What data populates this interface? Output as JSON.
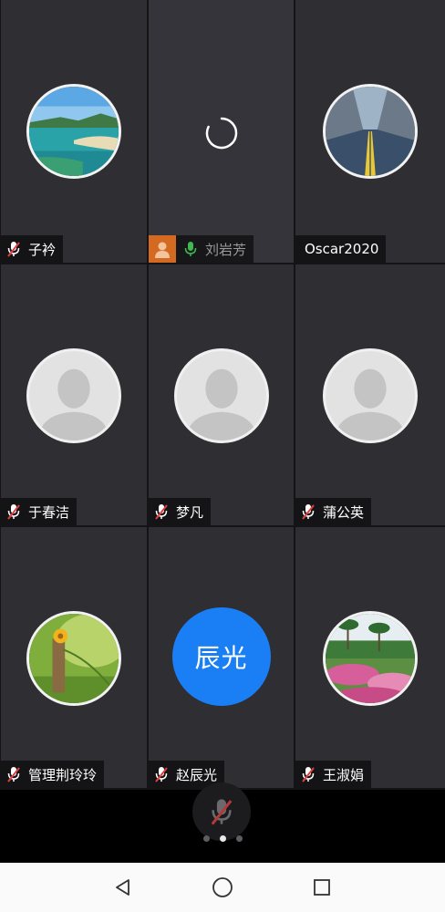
{
  "participants": [
    {
      "name": "子衿",
      "avatar": "beach-photo",
      "mic": "muted"
    },
    {
      "name": "刘岩芳",
      "avatar": "loading",
      "mic": "active"
    },
    {
      "name": "Oscar2020",
      "avatar": "street-photo",
      "mic": "none"
    },
    {
      "name": "于春洁",
      "avatar": "default-person",
      "mic": "muted"
    },
    {
      "name": "梦凡",
      "avatar": "default-person",
      "mic": "muted"
    },
    {
      "name": "蒲公英",
      "avatar": "default-person",
      "mic": "muted"
    },
    {
      "name": "管理荆玲玲",
      "avatar": "flower-photo",
      "mic": "muted"
    },
    {
      "name": "赵辰光",
      "avatar": "initials",
      "initials": "辰光",
      "mic": "muted"
    },
    {
      "name": "王淑娟",
      "avatar": "garden-photo",
      "mic": "muted"
    }
  ],
  "controls": {
    "self_mic_state": "muted",
    "icon": "microphone-muted-icon"
  },
  "pagination": {
    "total": 3,
    "current": 2
  },
  "navigation": {
    "back_icon": "triangle-back-icon",
    "home_icon": "circle-home-icon",
    "recents_icon": "square-recents-icon"
  },
  "colors": {
    "tile_bg": "#2e2e33",
    "initials_bg": "#1a7ef5",
    "mic_muted": "#e04040",
    "mic_active": "#3fb950"
  }
}
